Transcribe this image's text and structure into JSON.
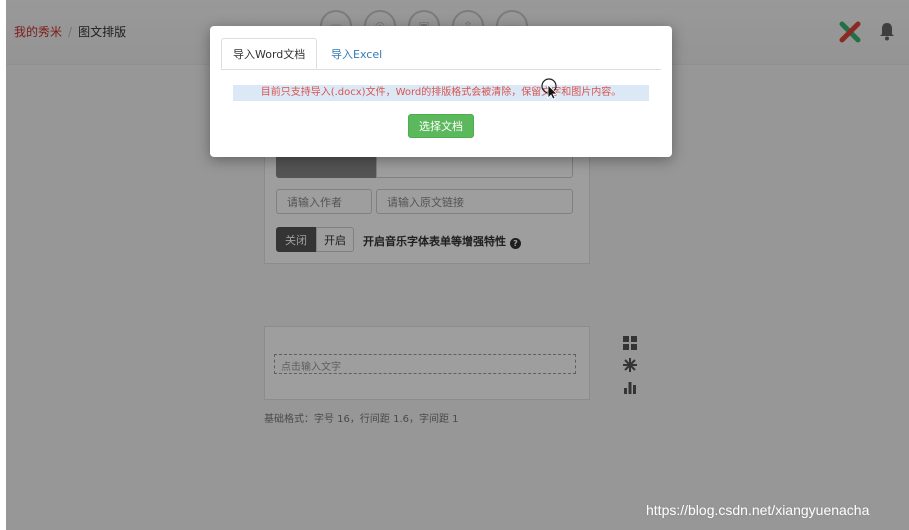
{
  "breadcrumb": {
    "home": "我的秀米",
    "separator": "/",
    "current": "图文排版"
  },
  "editor": {
    "author_placeholder": "请输入作者",
    "source_link_placeholder": "请输入原文链接",
    "toggle_off_label": "关闭",
    "toggle_on_label": "开启",
    "toggle_description": "开启音乐字体表单等增强特性",
    "content_placeholder": "点击输入文字",
    "base_format_note": "基础格式：字号 16，行间距 1.6，字间距 1"
  },
  "side_tools": [
    "grid-icon",
    "snowflake-icon",
    "bar-chart-icon"
  ],
  "modal": {
    "tabs": [
      {
        "label": "导入Word文档",
        "active": true
      },
      {
        "label": "导入Excel",
        "active": false
      }
    ],
    "notice": "目前只支持导入(.docx)文件，Word的排版格式会被清除，保留文字和图片内容。",
    "choose_button": "选择文档"
  },
  "watermark": "https://blog.csdn.net/xiangyuenacha",
  "colors": {
    "brand_red": "#c9302c",
    "button_green": "#5cb85c",
    "notice_bg": "#dbe9f6",
    "link_blue": "#337ab7"
  }
}
